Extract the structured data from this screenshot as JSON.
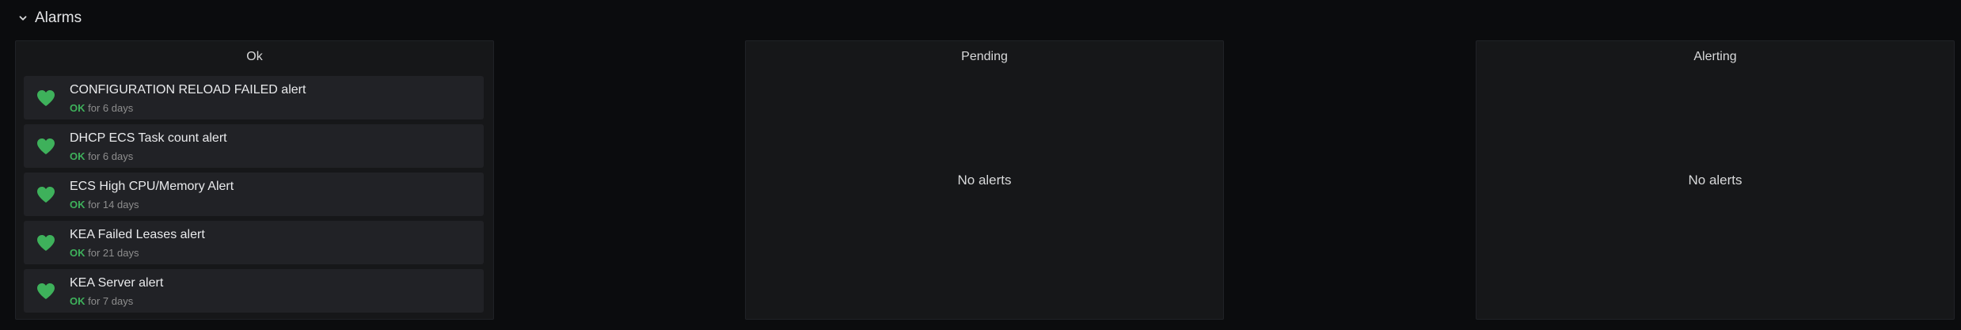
{
  "row": {
    "title": "Alarms",
    "chevron_icon": "chevron-down-icon"
  },
  "panels": {
    "ok": {
      "title": "Ok",
      "items": [
        {
          "name": "CONFIGURATION RELOAD FAILED alert",
          "state": "OK",
          "duration": "for 6 days",
          "icon": "heart-icon"
        },
        {
          "name": "DHCP ECS Task count alert",
          "state": "OK",
          "duration": "for 6 days",
          "icon": "heart-icon"
        },
        {
          "name": "ECS High CPU/Memory Alert",
          "state": "OK",
          "duration": "for 14 days",
          "icon": "heart-icon"
        },
        {
          "name": "KEA Failed Leases alert",
          "state": "OK",
          "duration": "for 21 days",
          "icon": "heart-icon"
        },
        {
          "name": "KEA Server alert",
          "state": "OK",
          "duration": "for 7 days",
          "icon": "heart-icon"
        }
      ]
    },
    "pending": {
      "title": "Pending",
      "empty_text": "No alerts"
    },
    "alerting": {
      "title": "Alerting",
      "empty_text": "No alerts"
    }
  },
  "colors": {
    "ok_green": "#3eb15b",
    "background": "#0b0c0e",
    "panel": "#161719",
    "item": "#212226"
  }
}
